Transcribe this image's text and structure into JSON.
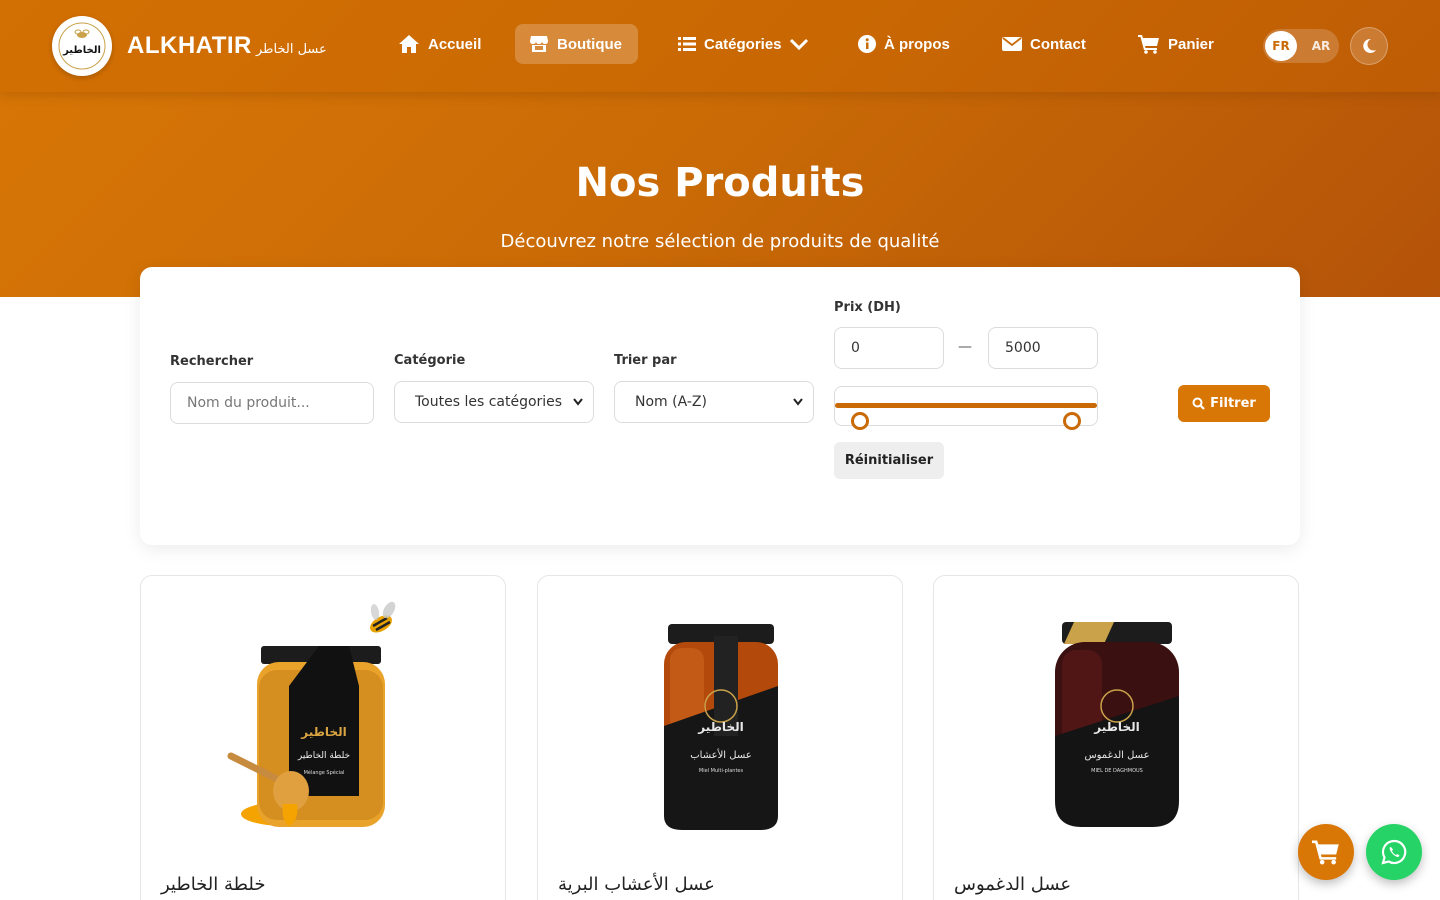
{
  "brand": {
    "name": "ALKHATIR",
    "name_ar": "عسل الخاطر",
    "logo_text": "الخاطير"
  },
  "nav": {
    "items": [
      {
        "label": "Accueil",
        "icon": "home-icon"
      },
      {
        "label": "Boutique",
        "icon": "store-icon",
        "active": true
      },
      {
        "label": "Catégories",
        "icon": "list-icon"
      },
      {
        "label": "À propos",
        "icon": "info-icon"
      },
      {
        "label": "Contact",
        "icon": "envelope-icon"
      },
      {
        "label": "Panier",
        "icon": "cart-icon"
      }
    ],
    "lang": {
      "fr": "FR",
      "ar": "AR",
      "selected": "FR"
    },
    "theme_icon": "moon-icon"
  },
  "hero": {
    "title": "Nos Produits",
    "subtitle": "Découvrez notre sélection de produits de qualité"
  },
  "filters": {
    "search": {
      "label": "Rechercher",
      "placeholder": "Nom du produit..."
    },
    "category": {
      "label": "Catégorie",
      "value": "Toutes les catégories"
    },
    "sort": {
      "label": "Trier par",
      "value": "Nom (A-Z)"
    },
    "price": {
      "label": "Prix (DH)",
      "min": "0",
      "max": "5000",
      "separator": "—",
      "range_min_fraction": 0.0,
      "range_max_fraction": 1.0
    },
    "reset_label": "Réinitialiser",
    "filter_label": "Filtrer"
  },
  "products": [
    {
      "name": "خلطة الخاطير",
      "jar_label": "خلطة الخاطير",
      "jar_sub": "Mélange Spécial",
      "brand_mark": "الخاطير"
    },
    {
      "name": "عسل الأعشاب البرية",
      "jar_label": "عسل الأعشاب",
      "jar_sub": "Miel Multi-plantes",
      "brand_mark": "الخاطير"
    },
    {
      "name": "عسل الدغموس",
      "jar_label": "عسل الدغموس",
      "jar_sub": "MIEL DE DAGHMOUS",
      "brand_mark": "الخاطير"
    }
  ],
  "colors": {
    "primary": "#d97706",
    "primary_dark": "#b45309",
    "whatsapp": "#25d366"
  }
}
